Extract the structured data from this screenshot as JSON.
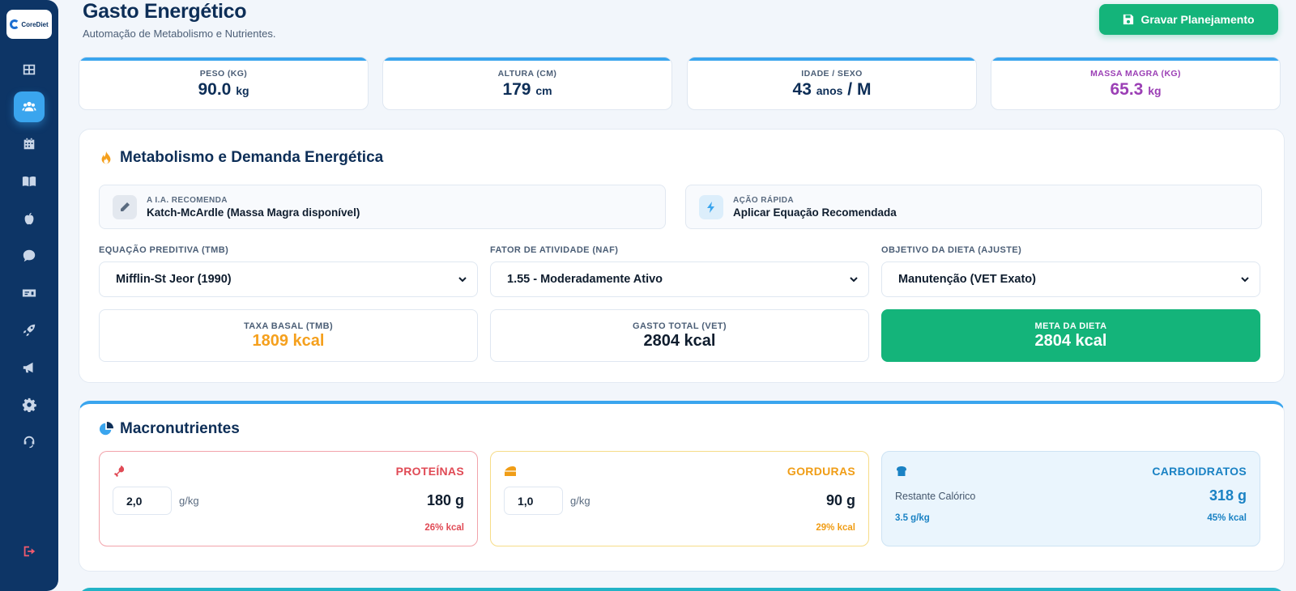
{
  "brand": {
    "logo_text": "CoreDiet"
  },
  "sidebar": {
    "items": [
      {
        "icon": "dashboard-icon"
      },
      {
        "icon": "users-icon"
      },
      {
        "icon": "calendar-icon"
      },
      {
        "icon": "book-icon"
      },
      {
        "icon": "apple-icon"
      },
      {
        "icon": "chat-icon"
      },
      {
        "icon": "billing-icon"
      },
      {
        "icon": "rocket-icon"
      },
      {
        "icon": "megaphone-icon"
      },
      {
        "icon": "settings-icon"
      },
      {
        "icon": "support-icon"
      }
    ],
    "active_index": 1,
    "logout_icon": "logout-icon"
  },
  "header": {
    "title": "Gasto Energético",
    "subtitle": "Automação de Metabolismo e Nutrientes.",
    "save_label": "Gravar Planejamento"
  },
  "stats": {
    "peso": {
      "label": "PESO (KG)",
      "value": "90.0",
      "unit": "kg"
    },
    "altura": {
      "label": "ALTURA (CM)",
      "value": "179",
      "unit": "cm"
    },
    "idade": {
      "label": "IDADE / SEXO",
      "value": "43",
      "unit": "anos",
      "sep": "/ M"
    },
    "massa": {
      "label": "MASSA MAGRA (KG)",
      "value": "65.3",
      "unit": "kg"
    }
  },
  "metabolism": {
    "title": "Metabolismo e Demanda Energética",
    "ai": {
      "label": "A I.A. RECOMENDA",
      "text": "Katch-McArdle (Massa Magra disponível)"
    },
    "quick": {
      "label": "AÇÃO RÁPIDA",
      "text": "Aplicar Equação Recomendada"
    },
    "equation": {
      "label": "EQUAÇÃO PREDITIVA (TMB)",
      "value": "Mifflin-St Jeor (1990)"
    },
    "activity": {
      "label": "FATOR DE ATIVIDADE (NAF)",
      "value": "1.55 - Moderadamente Ativo"
    },
    "goal": {
      "label": "OBJETIVO DA DIETA (AJUSTE)",
      "value": "Manutenção (VET Exato)"
    },
    "tmb": {
      "label": "TAXA BASAL (TMB)",
      "value": "1809 kcal"
    },
    "vet": {
      "label": "GASTO TOTAL (VET)",
      "value": "2804 kcal"
    },
    "meta": {
      "label": "META DA DIETA",
      "value": "2804 kcal"
    }
  },
  "macros": {
    "title": "Macronutrientes",
    "protein": {
      "name": "PROTEÍNAS",
      "input": "2,0",
      "unit": "g/kg",
      "grams": "180 g",
      "pct": "26% kcal"
    },
    "fat": {
      "name": "GORDURAS",
      "input": "1,0",
      "unit": "g/kg",
      "grams": "90 g",
      "pct": "29% kcal"
    },
    "carb": {
      "name": "CARBOIDRATOS",
      "rest_label": "Restante Calórico",
      "grams": "318 g",
      "gkg": "3.5 g/kg",
      "pct": "45% kcal"
    }
  },
  "colors": {
    "sidebar": "#0d3566",
    "accent": "#3aa5ee",
    "success": "#14b47a",
    "protein": "#e04a55",
    "fat": "#f09d16",
    "carb": "#1a82c4",
    "lean_mass": "#9b3fb5"
  }
}
